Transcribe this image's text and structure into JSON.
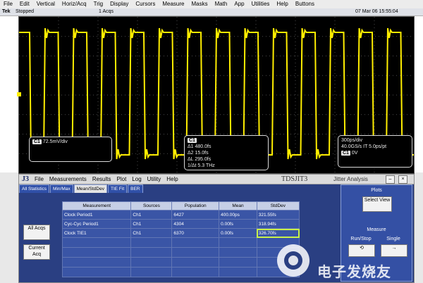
{
  "menubar": [
    "File",
    "Edit",
    "Vertical",
    "Horiz/Acq",
    "Trig",
    "Display",
    "Cursors",
    "Measure",
    "Masks",
    "Math",
    "App",
    "Utilities",
    "Help",
    "Buttons"
  ],
  "status": {
    "brand": "Tek",
    "state": "Stopped",
    "acqs": "1 Acqs",
    "datetime": "07 Mar 06 15:55:04"
  },
  "scope": {
    "trace_color": "#ffee00",
    "ch_readout": {
      "tag": "C1",
      "value": "72.5mV/div"
    },
    "meas_readout": {
      "tag": "C1",
      "lines": [
        "Δ1  480.0fs",
        "Δ2   15.0fs",
        "ΔL  295.0fs",
        "1/Δt  5.3  THz"
      ]
    },
    "timebase": {
      "lines": [
        "300ps/div",
        "40.0GS/s  IT 5.0ps/pt"
      ],
      "tag": "C1",
      "value": "0V"
    }
  },
  "jit": {
    "menu": [
      "File",
      "Measurements",
      "Results",
      "Plot",
      "Log",
      "Utility",
      "Help"
    ],
    "logo": "J3",
    "product": "TDSJIT3",
    "subtitle": "Jitter Analysis",
    "tabs": [
      "All Statistics",
      "Min/Max",
      "Mean/StdDev",
      "TIE Fit",
      "BER"
    ],
    "active_tab": 2,
    "left_buttons": {
      "all_acqs": "All Acqs",
      "current_acq": "Current Acq"
    },
    "table": {
      "headers": [
        "Measurement",
        "Sources",
        "Population",
        "Mean",
        "StdDev"
      ],
      "rows": [
        [
          "Clock Period1",
          "Ch1",
          "6427",
          "400.00ps",
          "321.55fs"
        ],
        [
          "Cyc-Cyc Period1",
          "Ch1",
          "4304",
          "0.00fs",
          "318.94fs"
        ],
        [
          "Clock TIE1",
          "Ch1",
          "6370",
          "0.00fs",
          "326.70fs"
        ]
      ]
    },
    "right": {
      "plots": "Plots",
      "select_view": "Select View",
      "measure": "Measure",
      "run_stop": "Run/Stop",
      "single": "Single"
    }
  },
  "watermark": {
    "text": "电子发烧友"
  }
}
